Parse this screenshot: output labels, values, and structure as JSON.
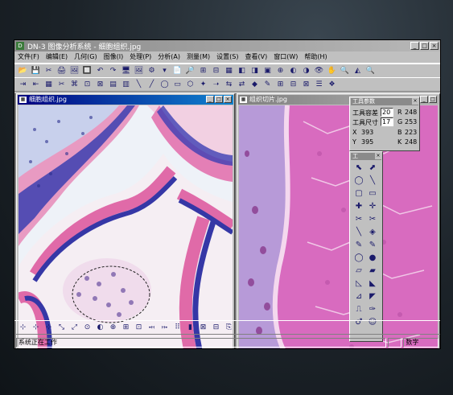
{
  "app": {
    "title": "DN-3 图像分析系统 - 细胞组织.jpg"
  },
  "menu": [
    "文件(F)",
    "编辑(E)",
    "几何(G)",
    "图像(I)",
    "处理(P)",
    "分析(A)",
    "测量(M)",
    "设置(S)",
    "查看(V)",
    "窗口(W)",
    "帮助(H)"
  ],
  "toolbar1": [
    "📂",
    "💾",
    "✂",
    "🖨",
    "🖼",
    "🔲",
    "↶",
    "↷",
    "🖥",
    "🖼",
    "⚙",
    "▾",
    "📄",
    "🔎",
    "⊞",
    "⊟",
    "▦",
    "◧",
    "◨",
    "▣",
    "⊕",
    "◐",
    "◑",
    "👁",
    "✋",
    "🔍",
    "◭",
    "🔍"
  ],
  "toolbar2": [
    "⇥",
    "⇤",
    "▦",
    "✂",
    "⌘",
    "⊡",
    "⊠",
    "▤",
    "▥",
    "╲",
    "╱",
    "◯",
    "▭",
    "⬡",
    "✦",
    "➝",
    "⇆",
    "⇄",
    "◆",
    "✎",
    "⊞",
    "⊟",
    "⊠",
    "☰",
    "❖"
  ],
  "bottom_toolbar": [
    "⊹",
    "⊹",
    "⊹",
    "⤡",
    "⤢",
    "⊙",
    "◐",
    "⊕",
    "⊞",
    "⊡",
    "⤟",
    "⤠",
    "⠿",
    "▮",
    "⊠",
    "⊟",
    "⎘"
  ],
  "window_left": {
    "title": "细胞组织.jpg"
  },
  "window_right": {
    "title": "组织切片.jpg"
  },
  "tool_params": {
    "title": "工具参数",
    "tolerance_label": "工具容差",
    "tolerance_value": "20",
    "size_label": "工具尺寸",
    "size_value": "17",
    "x_label": "X",
    "x_value": "393",
    "y_label": "Y",
    "y_value": "395",
    "r_label": "R",
    "r_value": "248",
    "g_label": "G",
    "g_value": "253",
    "b_label": "B",
    "b_value": "223",
    "k_label": "K",
    "k_value": "248"
  },
  "tool_palette": {
    "title": "工",
    "tools": [
      "⬉",
      "⬈",
      "◯",
      "╲",
      "▢",
      "▭",
      "✚",
      "✛",
      "✂",
      "✂",
      "╲",
      "◈",
      "✎",
      "✎",
      "◯",
      "●",
      "▱",
      "▰",
      "◺",
      "◣",
      "⊿",
      "◤",
      "⎍",
      "✑",
      "♂",
      "☺"
    ]
  },
  "status": {
    "text": "系统正在工作",
    "mode": "数字"
  },
  "colors": {
    "titlebar_active": "#000080",
    "window_bg": "#c0c0c0",
    "desktop": "#808080"
  }
}
